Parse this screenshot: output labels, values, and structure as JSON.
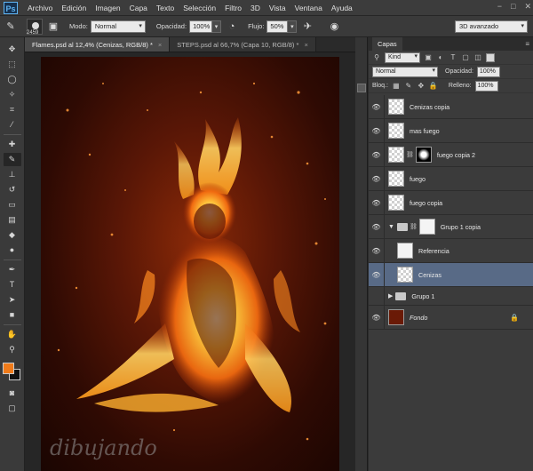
{
  "app": {
    "logo": "Ps"
  },
  "menu": [
    "Archivo",
    "Edición",
    "Imagen",
    "Capa",
    "Texto",
    "Selección",
    "Filtro",
    "3D",
    "Vista",
    "Ventana",
    "Ayuda"
  ],
  "window_controls": [
    "−",
    "□",
    "✕"
  ],
  "options": {
    "brush_size": "2459",
    "mode_label": "Modo:",
    "mode_value": "Normal",
    "opacity_label": "Opacidad:",
    "opacity_value": "100%",
    "flow_label": "Flujo:",
    "flow_value": "50%",
    "workspace": "3D avanzado"
  },
  "tabs": [
    {
      "label": "Flames.psd al 12,4% (Cenizas, RGB/8) *",
      "active": true
    },
    {
      "label": "STEPS.psd al 66,7% (Capa 10, RGB/8) *",
      "active": false
    }
  ],
  "watermark": "dibujando",
  "layers_panel": {
    "title": "Capas",
    "filter_kind": "Kind",
    "blend_mode": "Normal",
    "opacity_label": "Opacidad:",
    "opacity_value": "100%",
    "lock_label": "Bloq.:",
    "fill_label": "Relleno:",
    "fill_value": "100%",
    "layers": [
      {
        "name": "Cenizas copia",
        "thumb": "transparent"
      },
      {
        "name": "mas fuego",
        "thumb": "transparent"
      },
      {
        "name": "fuego copia 2",
        "thumb": "transparent"
      },
      {
        "name": "fuego",
        "thumb": "transparent"
      },
      {
        "name": "fuego copia",
        "thumb": "transparent"
      },
      {
        "name": "Grupo 1 copia",
        "thumb": "folder"
      },
      {
        "name": "Referencia",
        "thumb": "figure"
      },
      {
        "name": "Cenizas",
        "thumb": "transparent",
        "selected": true
      },
      {
        "name": "Grupo 1",
        "thumb": "folder"
      },
      {
        "name": "Fondo",
        "thumb": "fondo",
        "locked": true
      }
    ]
  },
  "colors": {
    "foreground": "#f07b1a",
    "background": "#111111",
    "selected_layer": "#586a86"
  }
}
